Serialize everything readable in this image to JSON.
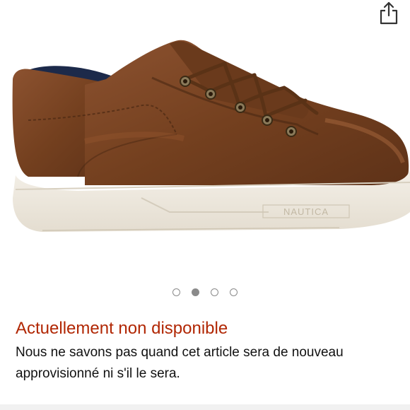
{
  "share": {
    "icon": "share-icon"
  },
  "product_image": {
    "brand_mark": "NAUTICA",
    "colors": {
      "leather": "#7a4424",
      "sole": "#efeae0",
      "lining": "#1c2a4a"
    }
  },
  "carousel": {
    "total": 4,
    "active_index": 1
  },
  "availability": {
    "title": "Actuellement non disponible",
    "description": "Nous ne savons pas quand cet article sera de nouveau approvisionné ni s'il le sera.",
    "title_color": "#b12704"
  }
}
